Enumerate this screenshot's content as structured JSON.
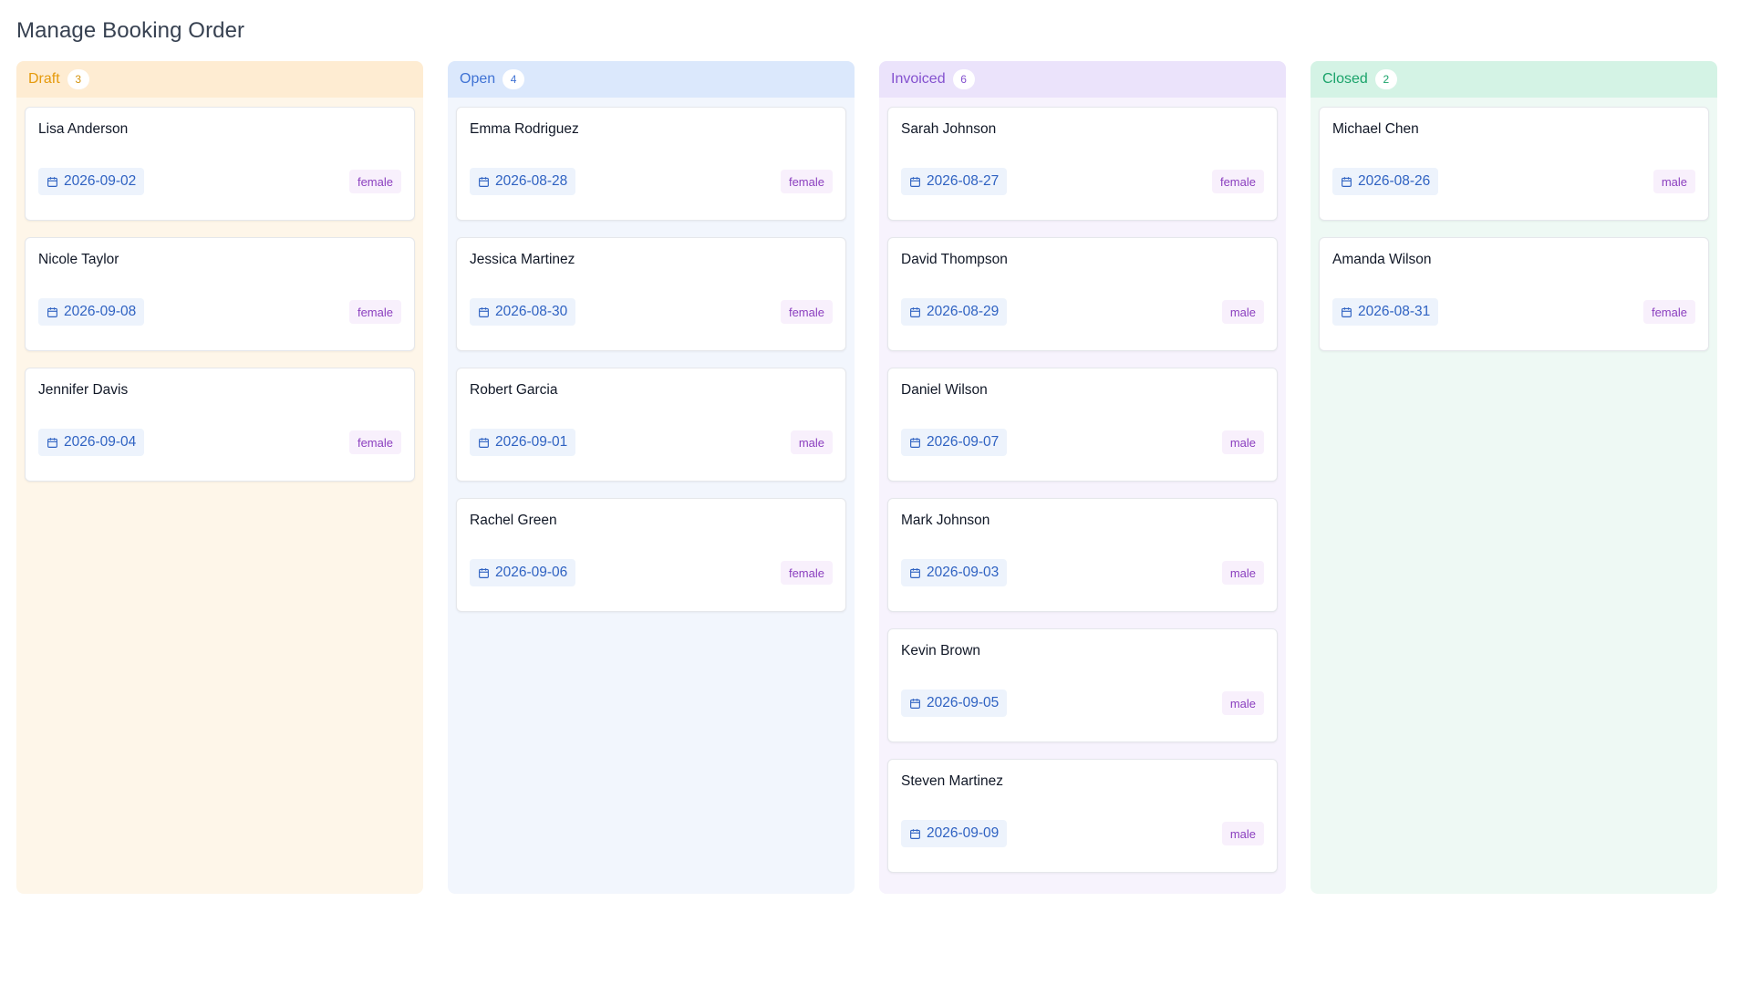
{
  "page": {
    "title": "Manage Booking Order"
  },
  "columns": [
    {
      "key": "draft",
      "label": "Draft",
      "count": "3",
      "accent": "#e59a0c",
      "cards": [
        {
          "name": "Lisa Anderson",
          "date": "2026-09-02",
          "gender": "female"
        },
        {
          "name": "Nicole Taylor",
          "date": "2026-09-08",
          "gender": "female"
        },
        {
          "name": "Jennifer Davis",
          "date": "2026-09-04",
          "gender": "female"
        }
      ]
    },
    {
      "key": "open",
      "label": "Open",
      "count": "4",
      "accent": "#3f72d4",
      "cards": [
        {
          "name": "Emma Rodriguez",
          "date": "2026-08-28",
          "gender": "female"
        },
        {
          "name": "Jessica Martinez",
          "date": "2026-08-30",
          "gender": "female"
        },
        {
          "name": "Robert Garcia",
          "date": "2026-09-01",
          "gender": "male"
        },
        {
          "name": "Rachel Green",
          "date": "2026-09-06",
          "gender": "female"
        }
      ]
    },
    {
      "key": "invoiced",
      "label": "Invoiced",
      "count": "6",
      "accent": "#8451cf",
      "cards": [
        {
          "name": "Sarah Johnson",
          "date": "2026-08-27",
          "gender": "female"
        },
        {
          "name": "David Thompson",
          "date": "2026-08-29",
          "gender": "male"
        },
        {
          "name": "Daniel Wilson",
          "date": "2026-09-07",
          "gender": "male"
        },
        {
          "name": "Mark Johnson",
          "date": "2026-09-03",
          "gender": "male"
        },
        {
          "name": "Kevin Brown",
          "date": "2026-09-05",
          "gender": "male"
        },
        {
          "name": "Steven Martinez",
          "date": "2026-09-09",
          "gender": "male"
        }
      ]
    },
    {
      "key": "closed",
      "label": "Closed",
      "count": "2",
      "accent": "#1aa36a",
      "cards": [
        {
          "name": "Michael Chen",
          "date": "2026-08-26",
          "gender": "male"
        },
        {
          "name": "Amanda Wilson",
          "date": "2026-08-31",
          "gender": "female"
        }
      ]
    }
  ],
  "icons": {
    "date": "calendar-icon"
  }
}
